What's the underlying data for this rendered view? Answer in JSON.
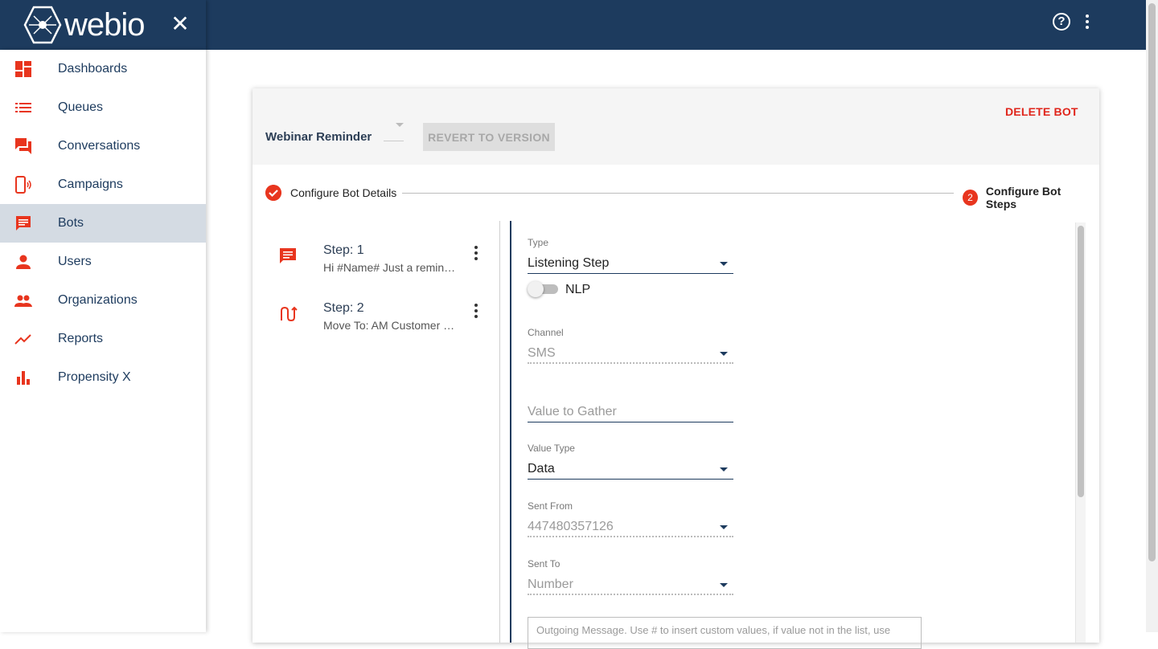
{
  "app": {
    "logo_text": "webio",
    "close_icon": "close-icon",
    "top_icons": [
      "help-circle-icon",
      "more-vert-icon"
    ]
  },
  "sidebar": {
    "accent_color": "#e8351e",
    "active_bg": "#d4dbe3",
    "items": [
      {
        "label": "Dashboards",
        "icon": "dashboard-icon"
      },
      {
        "label": "Queues",
        "icon": "list-icon"
      },
      {
        "label": "Conversations",
        "icon": "forum-icon"
      },
      {
        "label": "Campaigns",
        "icon": "phone-broadcast-icon"
      },
      {
        "label": "Bots",
        "icon": "chat-icon",
        "active": true
      },
      {
        "label": "Users",
        "icon": "person-icon"
      },
      {
        "label": "Organizations",
        "icon": "people-icon"
      },
      {
        "label": "Reports",
        "icon": "trending-up-icon"
      },
      {
        "label": "Propensity X",
        "icon": "bar-chart-icon"
      }
    ]
  },
  "header": {
    "bot_name": "Webinar Reminder",
    "revert_label": "REVERT TO VERSION",
    "delete_label": "DELETE BOT"
  },
  "stepper": {
    "step1_label": "Configure Bot Details",
    "step2_number": "2",
    "step2_label": "Configure Bot Steps"
  },
  "steps": [
    {
      "title": "Step: 1",
      "subtitle": "Hi #Name# Just a reminder",
      "icon": "message-icon"
    },
    {
      "title": "Step: 2",
      "subtitle": "Move To: AM Customer Service",
      "icon": "swap-arrows-icon"
    }
  ],
  "form": {
    "type_label": "Type",
    "type_value": "Listening Step",
    "nlp_label": "NLP",
    "nlp_enabled": false,
    "channel_label": "Channel",
    "channel_value": "SMS",
    "gather_placeholder": "Value to Gather",
    "value_type_label": "Value Type",
    "value_type_value": "Data",
    "sent_from_label": "Sent From",
    "sent_from_value": "447480357126",
    "sent_to_label": "Sent To",
    "sent_to_value": "Number",
    "message_placeholder": "Outgoing Message. Use # to insert custom values, if value not in the list, use"
  }
}
